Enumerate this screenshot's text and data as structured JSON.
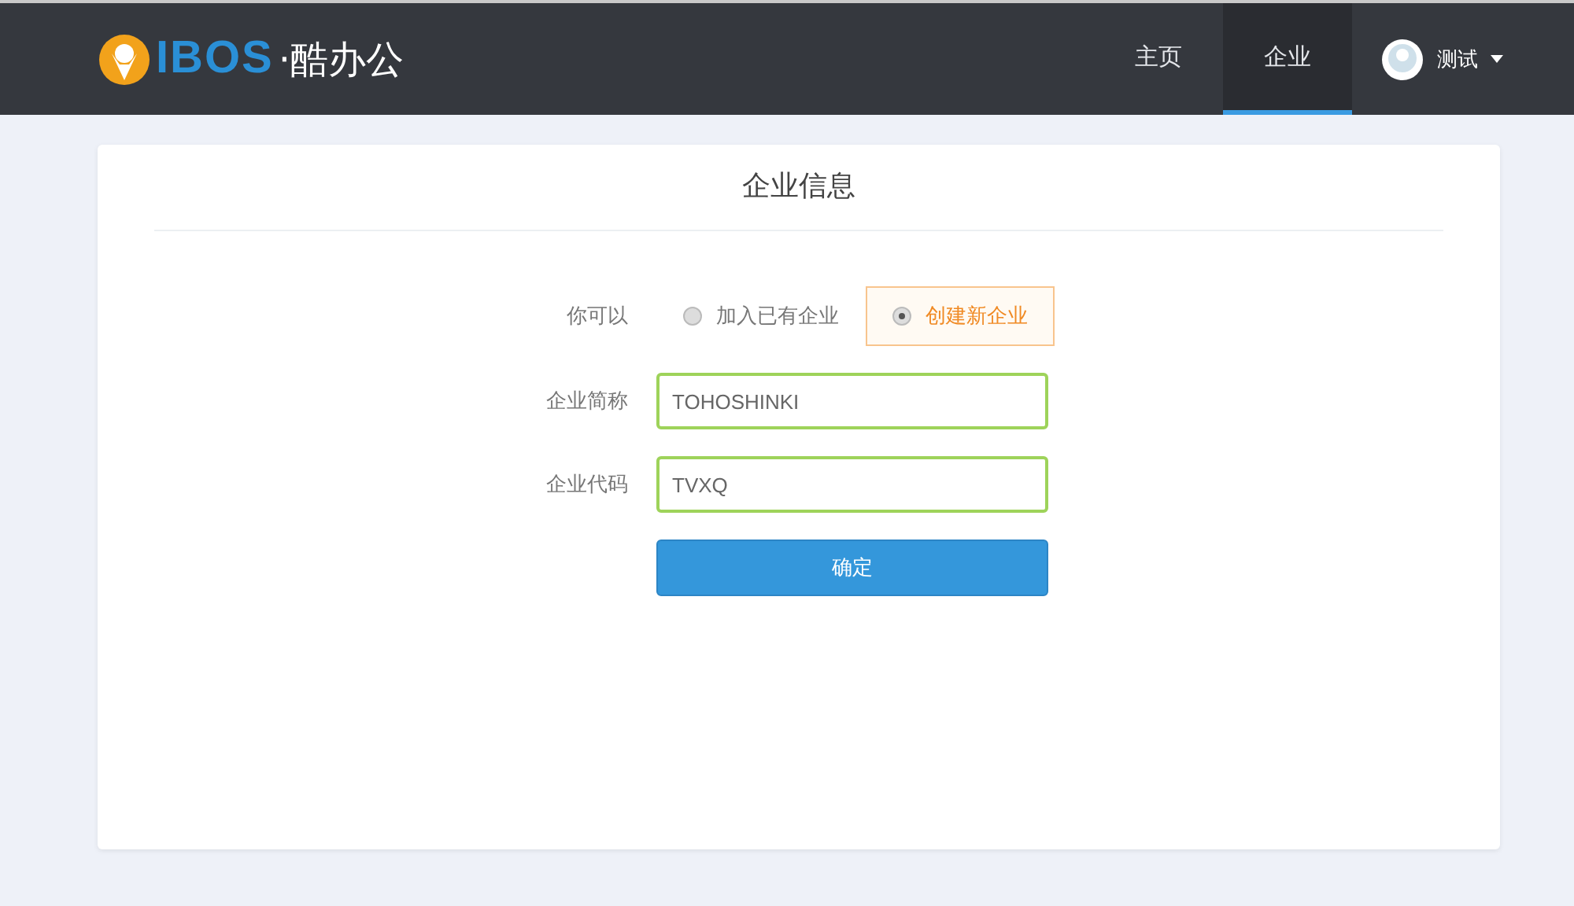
{
  "logo": {
    "brand": "IBOS",
    "suffix": "·酷办公"
  },
  "nav": [
    {
      "label": "主页",
      "selected": false
    },
    {
      "label": "企业",
      "selected": true
    }
  ],
  "user": {
    "name": "测试"
  },
  "card": {
    "title": "企业信息"
  },
  "form": {
    "choice_label": "你可以",
    "options": [
      {
        "label": "加入已有企业",
        "selected": false
      },
      {
        "label": "创建新企业",
        "selected": true
      }
    ],
    "fields": [
      {
        "label": "企业简称",
        "value": "TOHOSHINKI"
      },
      {
        "label": "企业代码",
        "value": "TVXQ"
      }
    ],
    "submit": "确定"
  }
}
